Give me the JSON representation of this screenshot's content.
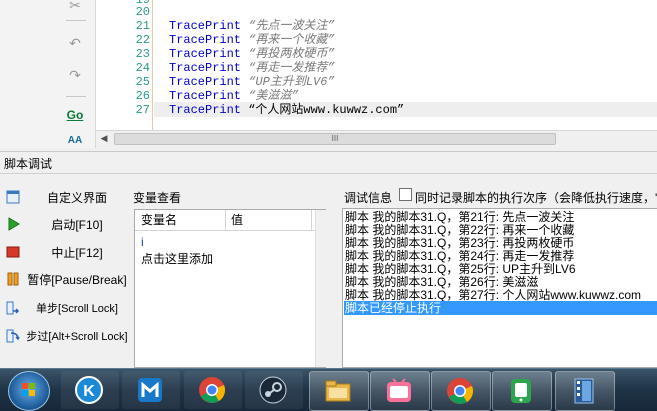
{
  "editor": {
    "toolbar_icons": [
      "cut-icon",
      "undo-icon",
      "redo-icon",
      "goto-icon",
      "find-replace-icon"
    ],
    "goto_label": "Go",
    "font_label": "AA",
    "line_numbers": [
      "19",
      "20",
      "21",
      "22",
      "23",
      "24",
      "25",
      "26",
      "27"
    ],
    "code_lines": [
      {
        "keyword": "",
        "text": ""
      },
      {
        "keyword": "",
        "text": ""
      },
      {
        "keyword": "TracePrint",
        "text": " “先点一波关注”"
      },
      {
        "keyword": "TracePrint",
        "text": " “再来一个收藏”"
      },
      {
        "keyword": "TracePrint",
        "text": " “再投两枚硬币”"
      },
      {
        "keyword": "TracePrint",
        "text": " “再走一发推荐”"
      },
      {
        "keyword": "TracePrint",
        "text": " “UP主升到LV6”"
      },
      {
        "keyword": "TracePrint",
        "text": " “美滋滋”"
      },
      {
        "keyword": "TracePrint",
        "text": " “个人网站www.kuwwz.com”"
      }
    ],
    "scroll_grip": "III"
  },
  "panel": {
    "title": "脚本调试",
    "controls": {
      "custom_ui": "自定义界面",
      "start": "启动[F10]",
      "stop": "中止[F12]",
      "pause": "暂停[Pause/Break]",
      "step": "单步[Scroll Lock]",
      "step_over": "步过[Alt+Scroll Lock]"
    },
    "variables": {
      "title": "变量查看",
      "col_name": "变量名",
      "col_value": "值",
      "rows": [
        "i",
        "点击这里添加"
      ]
    },
    "debug": {
      "title": "调试信息",
      "record_label": "同时记录脚本的执行次序（会降低执行速度，'",
      "log": [
        "脚本 我的脚本31.Q，第21行: 先点一波关注",
        "脚本 我的脚本31.Q，第22行: 再来一个收藏",
        "脚本 我的脚本31.Q，第23行: 再投两枚硬币",
        "脚本 我的脚本31.Q，第24行: 再走一发推荐",
        "脚本 我的脚本31.Q，第25行: UP主升到LV6",
        "脚本 我的脚本31.Q，第26行: 美滋滋",
        "脚本 我的脚本31.Q，第27行: 个人网站www.kuwwz.com",
        "脚本已经停止执行"
      ]
    }
  },
  "taskbar": {
    "apps": [
      "start-menu",
      "kuaikan-app",
      "maxthon-browser",
      "chrome-browser",
      "steam-app",
      "file-explorer",
      "bilibili-app",
      "chrome-browser-2",
      "wechat-app",
      "film-app"
    ],
    "colors": {
      "chrome_red": "#db4437",
      "chrome_green": "#0f9d58",
      "chrome_yellow": "#f4b400",
      "chrome_blue": "#4285f4",
      "bilibili_pink": "#fb7299",
      "accent": "#3399ff"
    }
  }
}
